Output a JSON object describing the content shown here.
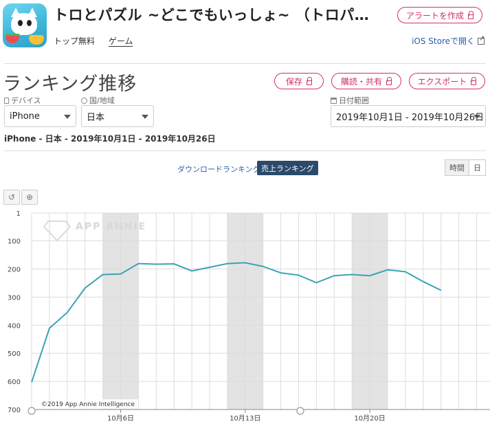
{
  "app": {
    "title": "トロとパズル ~どこでもいっしょ~ （トロパズ…",
    "publisher_label": "トップ無料",
    "genre_label": "ゲーム",
    "alert_button": "アラートを作成",
    "ios_store_link": "iOS Storeで開く"
  },
  "section": {
    "title": "ランキング推移",
    "save_button": "保存",
    "subscribe_button": "購読・共有",
    "export_button": "エクスポート"
  },
  "filters": {
    "device_label": "デバイス",
    "device_value": "iPhone",
    "country_label": "国/地域",
    "country_value": "日本",
    "date_label": "日付範囲",
    "date_value": "2019年10月1日 - 2019年10月26日",
    "summary": "iPhone - 日本 - 2019年10月1日 - 2019年10月26日"
  },
  "tabs": {
    "download_ranking": "ダウンロードランキング",
    "revenue_ranking": "売上ランキング",
    "hourly": "時間",
    "daily": "日"
  },
  "colors": {
    "accent": "#d0306c",
    "line": "#3ba3b4",
    "weekend_band": "#e3e3e3",
    "active_tab": "#2b4a6b"
  },
  "chart_data": {
    "type": "line",
    "watermark": "APP ANNIE",
    "copyright": "©2019 App Annie Intelligence",
    "y_axis": {
      "ticks": [
        1,
        100,
        200,
        300,
        400,
        500,
        600,
        700
      ],
      "ylim": [
        1,
        700
      ],
      "inverted": true
    },
    "x_axis": {
      "tick_labels": [
        {
          "day": 6,
          "label": "10月6日"
        },
        {
          "day": 13,
          "label": "10月13日"
        },
        {
          "day": 20,
          "label": "10月20日"
        }
      ],
      "xlim": [
        1,
        26
      ]
    },
    "weekend_bands": [
      [
        5,
        7
      ],
      [
        12,
        14
      ],
      [
        19,
        21
      ]
    ],
    "grid": true,
    "series": [
      {
        "days": [
          1,
          2,
          3,
          4,
          5,
          6,
          7,
          8,
          9,
          10,
          11,
          12,
          13,
          14,
          15,
          16,
          17,
          18,
          19,
          20,
          21,
          22,
          23,
          24,
          25,
          26
        ],
        "values": [
          603,
          411,
          355,
          268,
          220,
          218,
          181,
          183,
          182,
          207,
          194,
          181,
          178,
          191,
          214,
          222,
          249,
          224,
          220,
          224,
          203,
          210,
          245,
          276
        ]
      }
    ]
  }
}
